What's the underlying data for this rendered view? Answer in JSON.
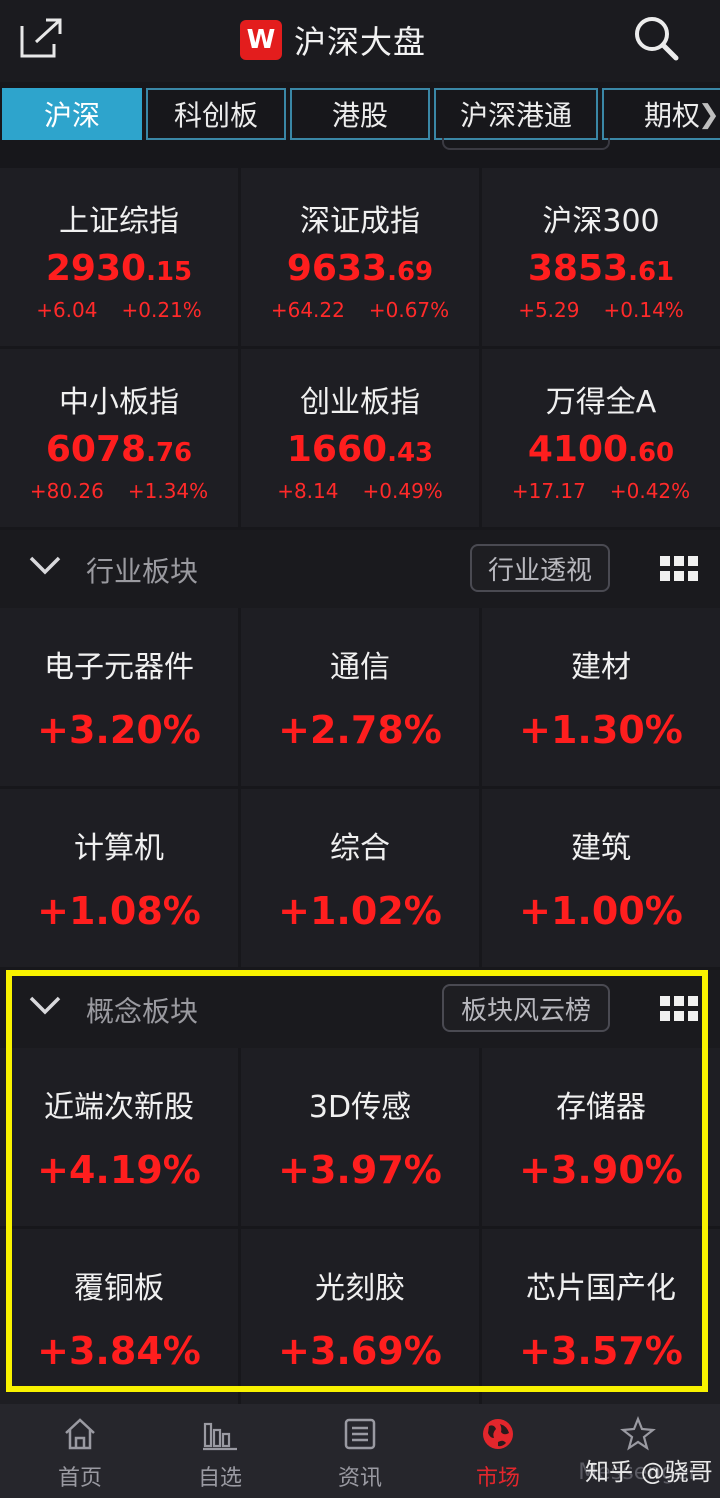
{
  "header": {
    "title": "沪深大盘",
    "logo_letter": "W",
    "share_icon": "share-icon",
    "search_icon": "search-icon"
  },
  "tabs": [
    {
      "label": "沪深",
      "active": true
    },
    {
      "label": "科创板",
      "active": false
    },
    {
      "label": "港股",
      "active": false
    },
    {
      "label": "沪深港通",
      "active": false
    },
    {
      "label": "期权",
      "active": false
    }
  ],
  "tabs_more": "❯",
  "indices": [
    {
      "name": "上证综指",
      "int": "2930",
      "dec": ".15",
      "change": "+6.04",
      "pct": "+0.21%"
    },
    {
      "name": "深证成指",
      "int": "9633",
      "dec": ".69",
      "change": "+64.22",
      "pct": "+0.67%"
    },
    {
      "name": "沪深300",
      "int": "3853",
      "dec": ".61",
      "change": "+5.29",
      "pct": "+0.14%"
    },
    {
      "name": "中小板指",
      "int": "6078",
      "dec": ".76",
      "change": "+80.26",
      "pct": "+1.34%"
    },
    {
      "name": "创业板指",
      "int": "1660",
      "dec": ".43",
      "change": "+8.14",
      "pct": "+0.49%"
    },
    {
      "name": "万得全A",
      "int": "4100",
      "dec": ".60",
      "change": "+17.17",
      "pct": "+0.42%"
    }
  ],
  "industry": {
    "title": "行业板块",
    "button": "行业透视",
    "items": [
      {
        "name": "电子元器件",
        "pct": "+3.20%"
      },
      {
        "name": "通信",
        "pct": "+2.78%"
      },
      {
        "name": "建材",
        "pct": "+1.30%"
      },
      {
        "name": "计算机",
        "pct": "+1.08%"
      },
      {
        "name": "综合",
        "pct": "+1.02%"
      },
      {
        "name": "建筑",
        "pct": "+1.00%"
      }
    ]
  },
  "concept": {
    "title": "概念板块",
    "button": "板块风云榜",
    "items": [
      {
        "name": "近端次新股",
        "pct": "+4.19%"
      },
      {
        "name": "3D传感",
        "pct": "+3.97%"
      },
      {
        "name": "存储器",
        "pct": "+3.90%"
      },
      {
        "name": "覆铜板",
        "pct": "+3.84%"
      },
      {
        "name": "光刻胶",
        "pct": "+3.69%"
      },
      {
        "name": "芯片国产化",
        "pct": "+3.57%"
      }
    ]
  },
  "bottom_nav": [
    {
      "label": "首页",
      "icon": "home-icon",
      "active": false
    },
    {
      "label": "自选",
      "icon": "bar-chart-icon",
      "active": false
    },
    {
      "label": "资讯",
      "icon": "news-icon",
      "active": false
    },
    {
      "label": "市场",
      "icon": "globe-icon",
      "active": true
    },
    {
      "label": "Messenger",
      "icon": "messenger-icon",
      "active": false
    }
  ],
  "watermark": "知乎 @骁哥",
  "colors": {
    "up": "#ff1e1e",
    "tab_active": "#2ea4cc",
    "highlight": "#f8f200",
    "nav_active": "#e3262c"
  }
}
